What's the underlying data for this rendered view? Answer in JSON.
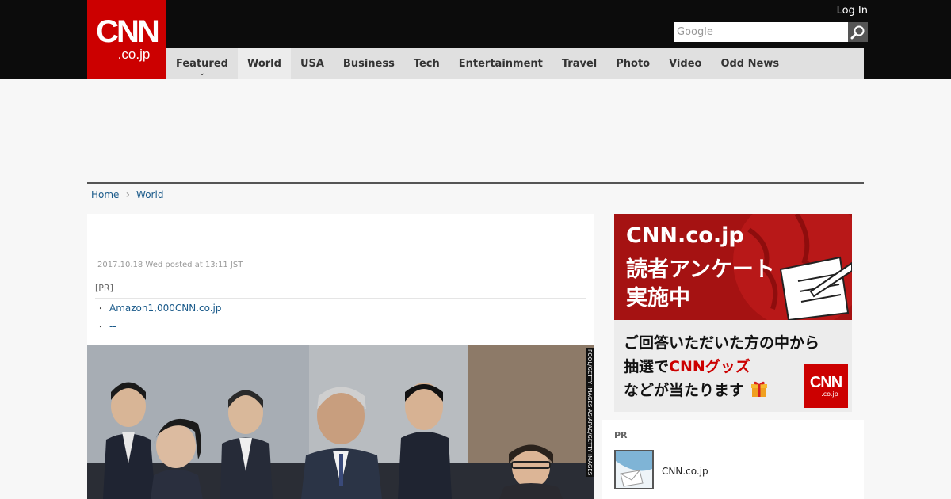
{
  "logo": {
    "line1": "CNN",
    "line2": ".co.jp"
  },
  "header": {
    "login_label": "Log In",
    "search_placeholder": "Google"
  },
  "nav": {
    "items": [
      {
        "label": "Featured",
        "has_dropdown": true
      },
      {
        "label": "World",
        "active": true
      },
      {
        "label": "USA"
      },
      {
        "label": "Business"
      },
      {
        "label": "Tech"
      },
      {
        "label": "Entertainment"
      },
      {
        "label": "Travel"
      },
      {
        "label": "Photo"
      },
      {
        "label": "Video"
      },
      {
        "label": "Odd News"
      }
    ]
  },
  "breadcrumb": {
    "home": "Home",
    "current": "World"
  },
  "article": {
    "date": "2017.10.18 Wed posted at 13:11 JST",
    "pr_tag": "[PR]",
    "pr_links": [
      "Amazon1,000CNN.co.jp",
      "--"
    ],
    "photo_credit": "POOL/GETTY IMAGES ASIAPAC/GETTY IMAGES"
  },
  "banner": {
    "line1": "CNN.co.jp",
    "line2": "読者アンケート",
    "line3": "実施中",
    "line4": "ご回答いただいた方の中から",
    "line5_prefix": "抽選で",
    "line5_red": "CNNグッズ",
    "line6": "などが当たります",
    "logo_line1": "CNN",
    "logo_line2": ".co.jp"
  },
  "side_pr": {
    "label": "PR",
    "text": "CNN.co.jp"
  },
  "colors": {
    "brand_red": "#cc0000",
    "topbar": "#0c0c0c",
    "nav_bg": "#e0e0e0",
    "link": "#1a5a8a"
  }
}
